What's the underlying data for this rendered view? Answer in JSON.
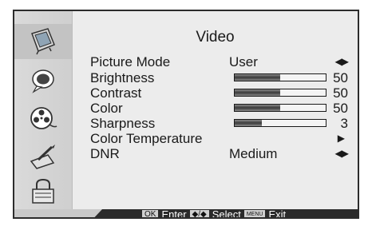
{
  "menu": {
    "title": "Video",
    "rows": {
      "picture_mode": {
        "label": "Picture Mode",
        "value": "User"
      },
      "brightness": {
        "label": "Brightness",
        "value": "50",
        "level": 0.5
      },
      "contrast": {
        "label": "Contrast",
        "value": "50",
        "level": 0.5
      },
      "color": {
        "label": "Color",
        "value": "50",
        "level": 0.5
      },
      "sharpness": {
        "label": "Sharpness",
        "value": "3",
        "level": 0.3
      },
      "color_temperature": {
        "label": "Color Temperature"
      },
      "dnr": {
        "label": "DNR",
        "value": "Medium"
      }
    }
  },
  "sidebar": {
    "items": [
      {
        "icon": "picture-icon",
        "active": true
      },
      {
        "icon": "audio-icon",
        "active": false
      },
      {
        "icon": "film-reel-icon",
        "active": false
      },
      {
        "icon": "setup-icon",
        "active": false
      },
      {
        "icon": "lock-icon",
        "active": false
      }
    ]
  },
  "hints": {
    "ok_key": "OK",
    "ok_label": "Enter",
    "select_key": "◆/◆",
    "select_label": "Select",
    "menu_key": "MENU",
    "menu_label": "Exit"
  }
}
